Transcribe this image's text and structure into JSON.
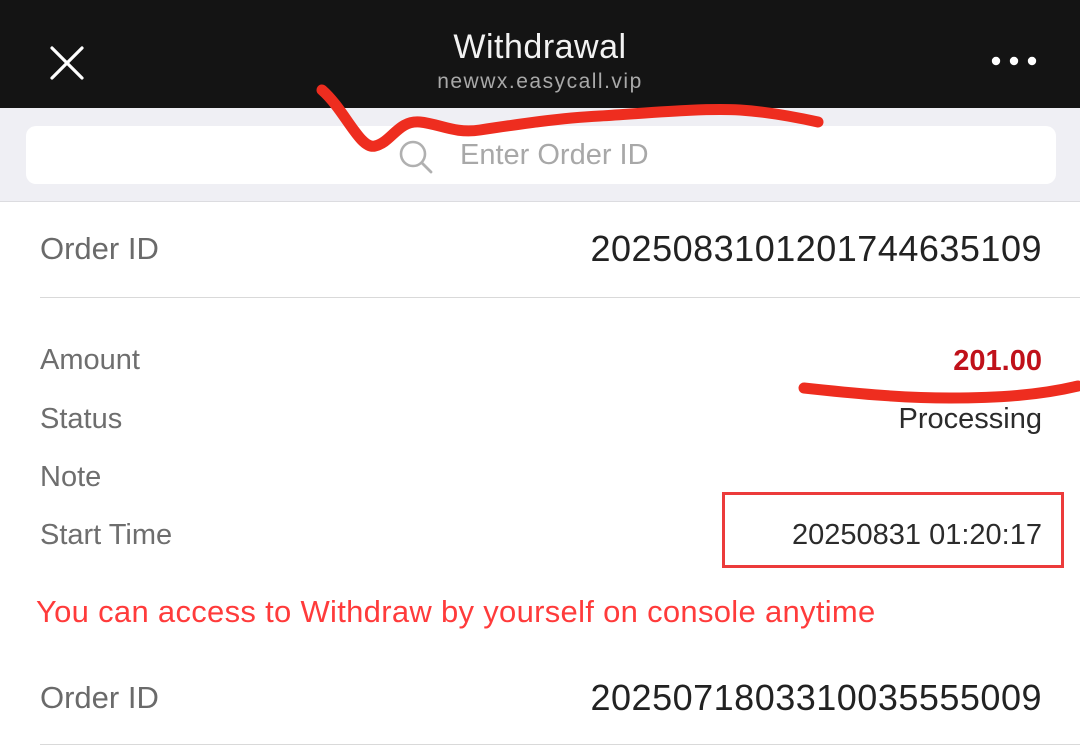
{
  "header": {
    "title": "Withdrawal",
    "subtitle": "newwx.easycall.vip",
    "close_icon": "close-icon",
    "more_icon": "more-horizontal-icon"
  },
  "search": {
    "placeholder": "Enter Order ID",
    "value": "",
    "icon": "search-icon"
  },
  "orders": [
    {
      "order_id_label": "Order ID",
      "order_id": "20250831012017446351​09",
      "amount_label": "Amount",
      "amount": "201.00",
      "status_label": "Status",
      "status": "Processing",
      "note_label": "Note",
      "note": "",
      "start_time_label": "Start Time",
      "start_time": "20250831 01:20:17"
    },
    {
      "order_id_label": "Order ID",
      "order_id": "20250718033100355550​09"
    }
  ],
  "notice": "You can access to Withdraw by yourself on console anytime",
  "colors": {
    "header_bg": "#141414",
    "amount": "#c0111a",
    "notice": "#ff3b3b",
    "annotation": "#ec3b3b"
  }
}
